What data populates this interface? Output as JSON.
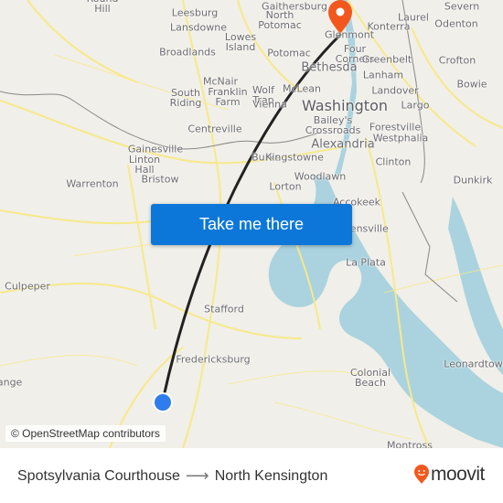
{
  "map": {
    "attribution": "© OpenStreetMap contributors",
    "colors": {
      "land": "#f1efe9",
      "water": "#aad3df",
      "road": "#f7e98a",
      "route_line": "#222222",
      "origin_marker": "#2f7ded",
      "destination_marker": "#f2581e"
    },
    "places": [
      {
        "name": "Round\nHill",
        "size": "small"
      },
      {
        "name": "Leesburg",
        "size": "small"
      },
      {
        "name": "Gaithersburg",
        "size": "small"
      },
      {
        "name": "North\nPotomac",
        "size": "small"
      },
      {
        "name": "Lansdowne",
        "size": "small"
      },
      {
        "name": "Lowes\nIsland",
        "size": "small"
      },
      {
        "name": "Broadlands",
        "size": "small"
      },
      {
        "name": "Potomac",
        "size": "small"
      },
      {
        "name": "McNair",
        "size": "small"
      },
      {
        "name": "South\nRiding",
        "size": "small"
      },
      {
        "name": "Franklin\nFarm",
        "size": "small"
      },
      {
        "name": "Wolf\nTrap",
        "size": "small"
      },
      {
        "name": "Vienna",
        "size": "small"
      },
      {
        "name": "McLean",
        "size": "small"
      },
      {
        "name": "Bethesda",
        "size": "mid"
      },
      {
        "name": "Glenmont",
        "size": "small"
      },
      {
        "name": "Four\nCorners",
        "size": "small"
      },
      {
        "name": "Laurel",
        "size": "small"
      },
      {
        "name": "Konterra",
        "size": "small"
      },
      {
        "name": "Severn",
        "size": "small"
      },
      {
        "name": "Odenton",
        "size": "small"
      },
      {
        "name": "Greenbelt",
        "size": "small"
      },
      {
        "name": "Crofton",
        "size": "small"
      },
      {
        "name": "Lanham",
        "size": "small"
      },
      {
        "name": "Bowie",
        "size": "small"
      },
      {
        "name": "Landover",
        "size": "small"
      },
      {
        "name": "Largo",
        "size": "small"
      },
      {
        "name": "Washington",
        "size": "big"
      },
      {
        "name": "Centreville",
        "size": "small"
      },
      {
        "name": "Bailey's\nCrossroads",
        "size": "small"
      },
      {
        "name": "Forestville",
        "size": "small"
      },
      {
        "name": "Westphalia",
        "size": "small"
      },
      {
        "name": "Alexandria",
        "size": "mid"
      },
      {
        "name": "Gainesville",
        "size": "small"
      },
      {
        "name": "Linton\nHall",
        "size": "small"
      },
      {
        "name": "Burke",
        "size": "small"
      },
      {
        "name": "Kingstowne",
        "size": "small"
      },
      {
        "name": "Clinton",
        "size": "small"
      },
      {
        "name": "Woodlawn",
        "size": "small"
      },
      {
        "name": "Bristow",
        "size": "small"
      },
      {
        "name": "Warrenton",
        "size": "small"
      },
      {
        "name": "Lorton",
        "size": "small"
      },
      {
        "name": "Dunkirk",
        "size": "small"
      },
      {
        "name": "Accokeek",
        "size": "small"
      },
      {
        "name": "Bensville",
        "size": "small"
      },
      {
        "name": "La Plata",
        "size": "small"
      },
      {
        "name": "Culpeper",
        "size": "small"
      },
      {
        "name": "Stafford",
        "size": "small"
      },
      {
        "name": "Fredericksburg",
        "size": "small"
      },
      {
        "name": "Leonardtown",
        "size": "small"
      },
      {
        "name": "Colonial\nBeach",
        "size": "small"
      },
      {
        "name": "Montross",
        "size": "small"
      },
      {
        "name": "Orange",
        "size": "small"
      }
    ]
  },
  "cta": {
    "label": "Take me there"
  },
  "footer": {
    "origin": "Spotsylvania Courthouse",
    "arrow_icon": "arrow-right-icon",
    "destination": "North Kensington",
    "brand": "moovit",
    "brand_color": "#f2581e"
  }
}
